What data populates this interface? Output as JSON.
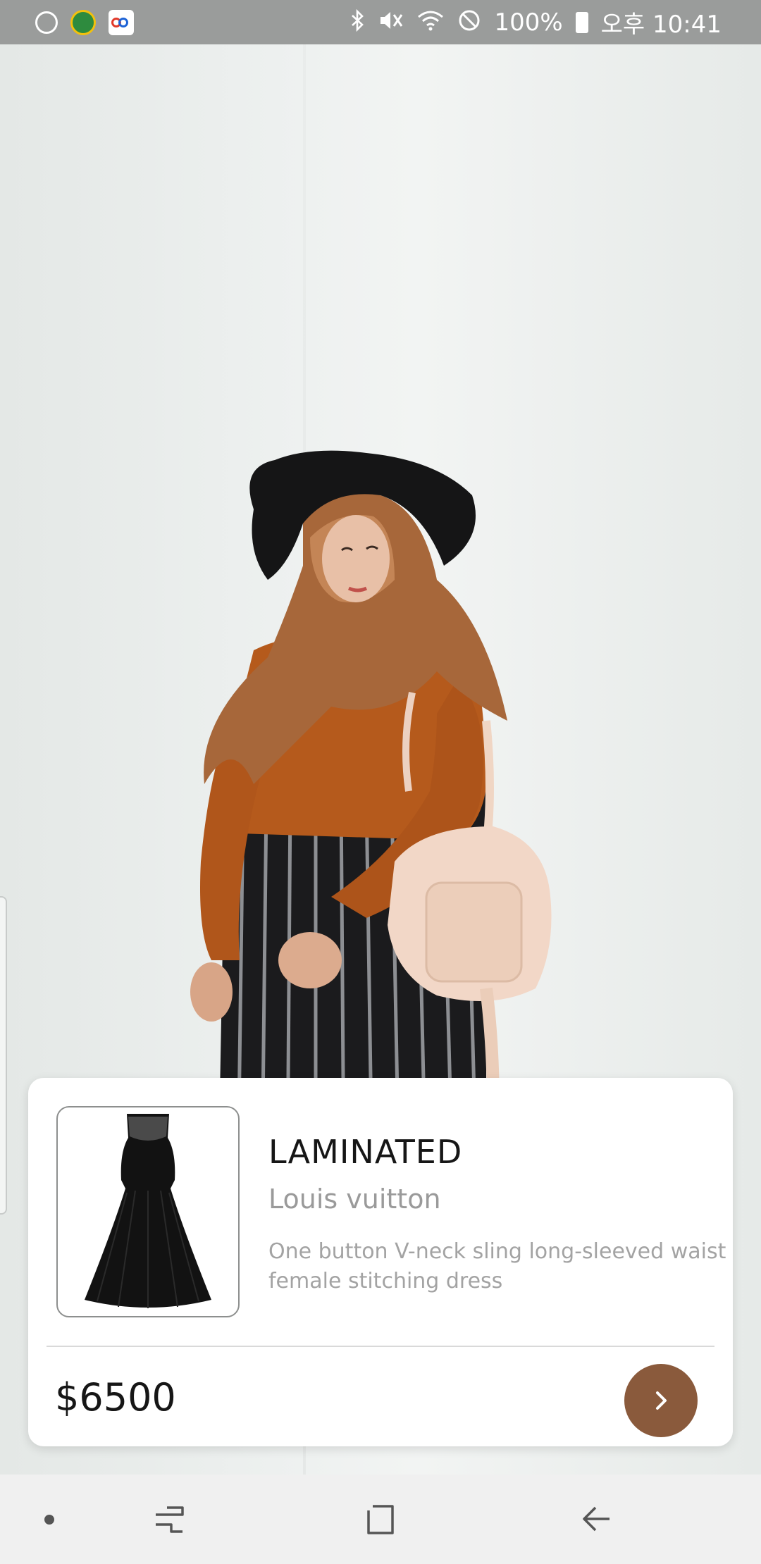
{
  "status_bar": {
    "notifications": [
      "sync-icon",
      "app-badge-icon",
      "rings-app-icon"
    ],
    "system_icons": [
      "bluetooth-icon",
      "mute-icon",
      "wifi-icon",
      "do-not-disturb-icon"
    ],
    "battery_percent": "100%",
    "time": "오후 10:41"
  },
  "product": {
    "title": "LAMINATED",
    "brand": "Louis vuitton",
    "description": "One button V-neck sling long-sleeved waist female stitching dress",
    "price": "$6500"
  },
  "colors": {
    "accent": "#8a5a3c",
    "status_bar": "#9a9c9b",
    "nav_bar": "#f0f0f0"
  },
  "nav_bar": {
    "items": [
      "dot-icon",
      "recent-apps-icon",
      "home-icon",
      "back-icon"
    ]
  }
}
